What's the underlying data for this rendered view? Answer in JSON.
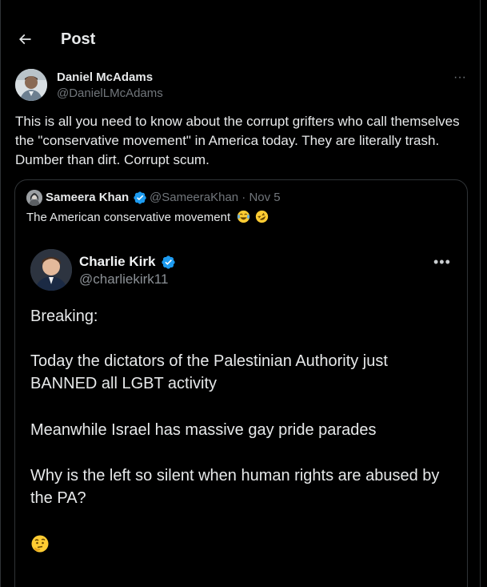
{
  "header": {
    "title": "Post"
  },
  "post": {
    "author_name": "Daniel McAdams",
    "author_handle": "@DanielLMcAdams",
    "more_label": "···",
    "text": "This is all you need to know about the corrupt grifters who call themselves the \"conservative movement\" in America today. They are literally trash. Dumber than dirt. Corrupt scum."
  },
  "quote": {
    "author_name": "Sameera Khan",
    "author_handle": "@SameeraKhan · Nov 5",
    "text": "The American conservative movement",
    "emojis": [
      "face-with-tears-of-joy-icon",
      "rolling-on-floor-laughing-icon"
    ]
  },
  "embedded": {
    "author_name": "Charlie Kirk",
    "author_handle": "@charliekirk11",
    "more_label": "•••",
    "paragraphs": [
      "Breaking:",
      "Today the dictators of the Palestinian Authority just BANNED all LGBT activity",
      "Meanwhile Israel has massive gay pride parades",
      "Why is the left so silent when human rights are abused by the PA?"
    ],
    "closing_emoji": "thinking-face-icon"
  },
  "colors": {
    "background": "#000000",
    "text": "#e7e9ea",
    "secondary": "#71767b",
    "border": "#2f3336",
    "verified": "#1d9bf0"
  }
}
